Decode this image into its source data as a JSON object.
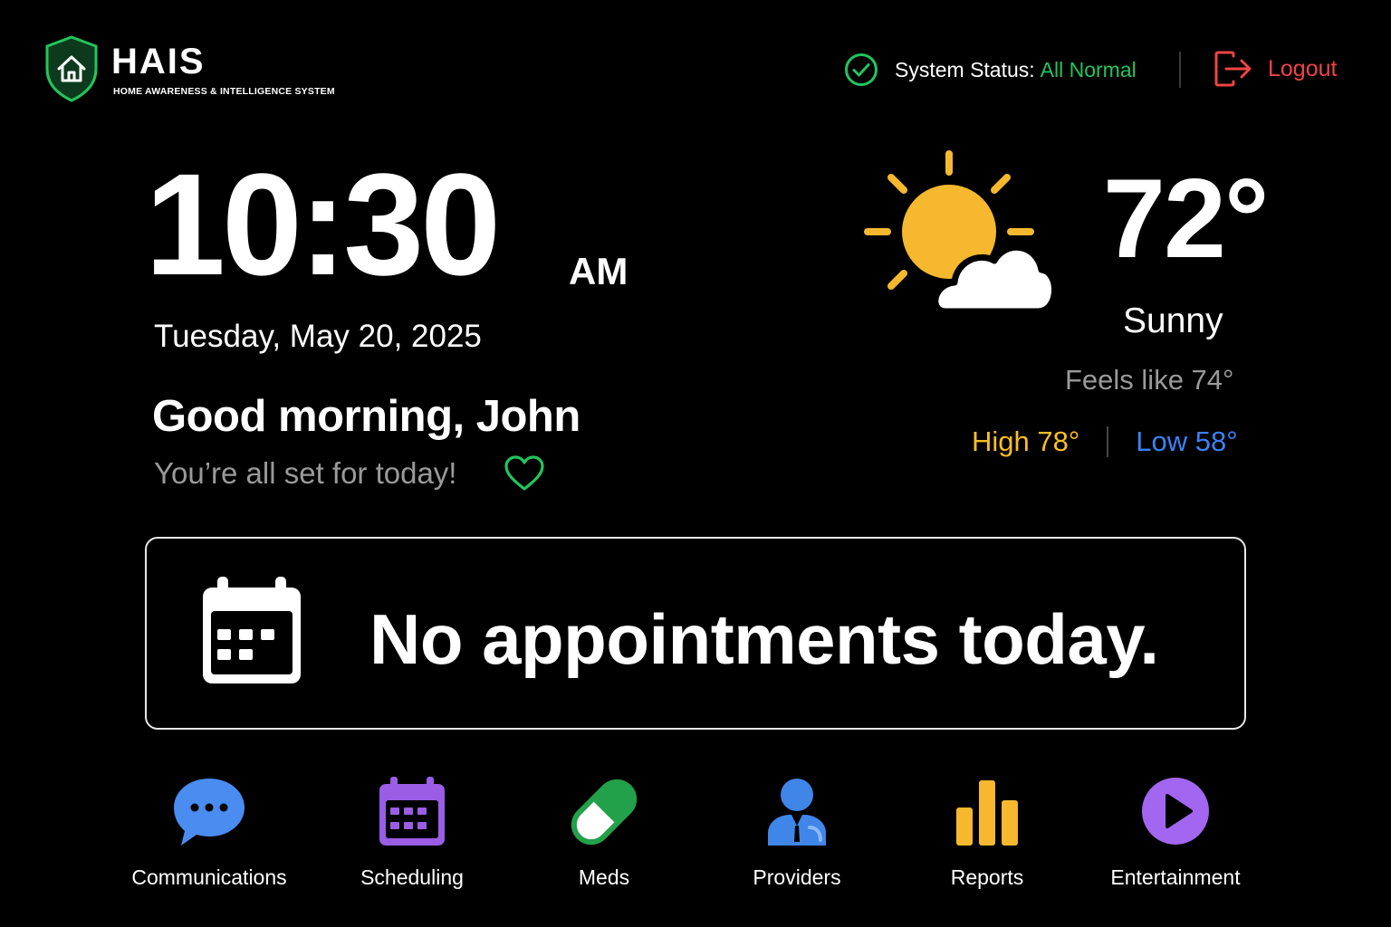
{
  "header": {
    "app_name": "HAIS",
    "app_subtitle": "HOME AWARENESS & INTELLIGENCE SYSTEM",
    "status_label": "System Status:",
    "status_value": "All Normal",
    "logout_label": "Logout"
  },
  "clock": {
    "time": "10:30",
    "ampm": "AM",
    "date": "Tuesday, May 20, 2025"
  },
  "greeting": {
    "message": "Good morning, John",
    "tagline": "You’re all set for today!"
  },
  "weather": {
    "temperature": "72°",
    "condition": "Sunny",
    "feels_like": "Feels like 74°",
    "high": "High 78°",
    "low": "Low 58°"
  },
  "appointments": {
    "message": "No appointments today."
  },
  "nav": {
    "items": [
      {
        "label": "Communications",
        "icon": "chat-bubble-icon"
      },
      {
        "label": "Scheduling",
        "icon": "calendar-icon"
      },
      {
        "label": "Meds",
        "icon": "pill-icon"
      },
      {
        "label": "Providers",
        "icon": "doctor-icon"
      },
      {
        "label": "Reports",
        "icon": "bar-chart-icon"
      },
      {
        "label": "Entertainment",
        "icon": "play-icon"
      }
    ]
  },
  "colors": {
    "accent_green": "#22c55e",
    "logout_red": "#ef4444",
    "high_yellow": "#fbbf24",
    "low_blue": "#3b82f6",
    "chat_blue": "#4a8cf0",
    "calendar_purple": "#9b5de5",
    "provider_blue": "#3f86e8",
    "reports_yellow": "#f5b82e",
    "play_purple": "#a366f0"
  }
}
